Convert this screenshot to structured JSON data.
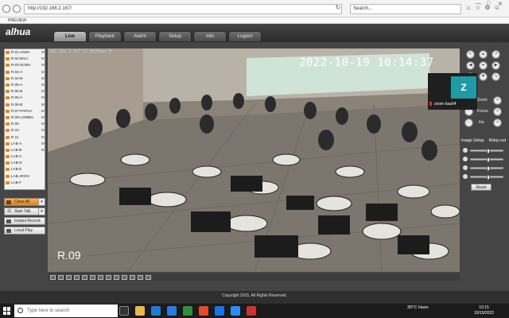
{
  "browser": {
    "url": "http://192.168.2.167/",
    "search_placeholder": "Search...",
    "tab_title": "PREVIEW",
    "window_controls": [
      "—",
      "□",
      "✕"
    ]
  },
  "app": {
    "logo": "alhua",
    "nav_tabs": [
      "Live",
      "Playback",
      "Alarm",
      "Setup",
      "Info",
      "Logout"
    ],
    "active_tab": "Live"
  },
  "channels": [
    {
      "label": "R.01-JAWA",
      "m": "M"
    },
    {
      "label": "R.02-BALI",
      "m": "M"
    },
    {
      "label": "R.03-SUMA",
      "m": "M"
    },
    {
      "label": "R.04-A",
      "m": "M"
    },
    {
      "label": "R.04-B",
      "m": "M"
    },
    {
      "label": "R.05-A",
      "m": "M"
    },
    {
      "label": "R.05-B",
      "m": "M"
    },
    {
      "label": "R.06-A",
      "m": "M"
    },
    {
      "label": "R.06-B",
      "m": "M"
    },
    {
      "label": "R.07-PAPUA",
      "m": "M"
    },
    {
      "label": "R.08-LOMBO",
      "m": "M"
    },
    {
      "label": "R.09",
      "m": "M"
    },
    {
      "label": "R.10",
      "m": "M"
    },
    {
      "label": "R.11",
      "m": "M"
    },
    {
      "label": "LAB-A",
      "m": "M"
    },
    {
      "label": "LAB-B",
      "m": "M"
    },
    {
      "label": "LAB-C",
      "m": ""
    },
    {
      "label": "LAB-D",
      "m": ""
    },
    {
      "label": "LAB-E",
      "m": ""
    },
    {
      "label": "LAB-JRGN",
      "m": ""
    },
    {
      "label": "LAB-F",
      "m": ""
    }
  ],
  "side_buttons": {
    "close_all": "Close All",
    "start_talk": "Start Talk",
    "instant_record": "Instant Record",
    "local_play": "Local Play"
  },
  "video": {
    "info": "192.168.2.167_12_0699bps_M",
    "timestamp": "2022-10-19  10:14:37",
    "room_label": "R.09"
  },
  "zoom": {
    "initial": "Z",
    "name": "zoom baa04"
  },
  "ptz": {
    "zoom_label": "Zoom",
    "focus_label": "Focus",
    "iris_label": "Iris"
  },
  "image_setup": {
    "title": "Image Setup",
    "relay": "Relay-out",
    "reset": "Reset",
    "sliders": [
      0.55,
      0.55,
      0.55,
      0.55
    ]
  },
  "footer": "Copyright 2015, All Rights Reserved.",
  "taskbar": {
    "search_placeholder": "Type here to search",
    "weather": "30°C  Haze",
    "time": "10:15",
    "date": "10/19/2022"
  }
}
